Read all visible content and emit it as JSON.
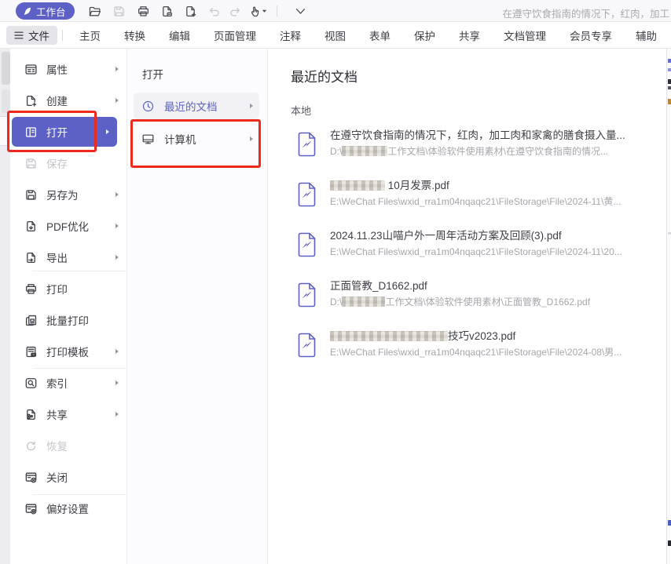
{
  "colors": {
    "accent": "#5d61c5",
    "annotation_red": "#ec2a1d",
    "disabled_gray": "#c6c6cc"
  },
  "titlebar": {
    "workbench_label": "工作台",
    "document_title": "在遵守饮食指南的情况下，红肉，加工"
  },
  "menubar": {
    "items": [
      "文件",
      "主页",
      "转换",
      "编辑",
      "页面管理",
      "注释",
      "视图",
      "表单",
      "保护",
      "共享",
      "文档管理",
      "会员专享",
      "辅助"
    ],
    "active_item": "文件"
  },
  "file_menu": {
    "items": [
      {
        "label": "属性",
        "icon": "properties-icon",
        "has_submenu": true
      },
      {
        "label": "创建",
        "icon": "create-icon",
        "has_submenu": true
      },
      {
        "label": "打开",
        "icon": "open-icon",
        "has_submenu": true,
        "selected": true
      },
      {
        "label": "保存",
        "icon": "save-icon",
        "disabled": true
      },
      {
        "label": "另存为",
        "icon": "save-as-icon",
        "has_submenu": true
      },
      {
        "label": "PDF优化",
        "icon": "pdf-optimize-icon",
        "has_submenu": true
      },
      {
        "label": "导出",
        "icon": "export-icon",
        "has_submenu": true
      },
      {
        "label": "打印",
        "icon": "print-icon"
      },
      {
        "label": "批量打印",
        "icon": "batch-print-icon"
      },
      {
        "label": "打印模板",
        "icon": "print-template-icon",
        "has_submenu": true
      },
      {
        "label": "索引",
        "icon": "index-icon",
        "has_submenu": true
      },
      {
        "label": "共享",
        "icon": "share-icon",
        "has_submenu": true
      },
      {
        "label": "恢复",
        "icon": "restore-icon",
        "disabled": true
      },
      {
        "label": "关闭",
        "icon": "close-doc-icon"
      },
      {
        "label": "偏好设置",
        "icon": "preferences-icon"
      }
    ]
  },
  "open_panel": {
    "title": "打开",
    "items": [
      {
        "label": "最近的文档",
        "icon": "clock-icon",
        "selected": true,
        "has_submenu": true
      },
      {
        "label": "计算机",
        "icon": "computer-icon",
        "has_submenu": true
      }
    ]
  },
  "main": {
    "heading": "最近的文档",
    "section_label": "本地",
    "documents": [
      {
        "title": "在遵守饮食指南的情况下，红肉，加工肉和家禽的膳食摄入量...",
        "path_start": "D:\\",
        "path_redacted": true,
        "path_end": "工作文档\\体验软件使用素材\\在遵守饮食指南的情况..."
      },
      {
        "title_redacted": true,
        "title": "10月发票.pdf",
        "path_start": "E:\\WeChat Files\\wxid_rra1m04nqaqc21\\FileStorage\\File\\2024-11\\黄..."
      },
      {
        "title": "2024.11.23山喵户外一周年活动方案及回顾(3).pdf",
        "path_start": "E:\\WeChat Files\\wxid_rra1m04nqaqc21\\FileStorage\\File\\2024-11\\20..."
      },
      {
        "title": "正面管教_D1662.pdf",
        "path_start": "D:\\",
        "path_redacted": true,
        "path_end": "工作文档\\体验软件使用素材\\正面管教_D1662.pdf"
      },
      {
        "title_redacted": true,
        "title": "技巧v2023.pdf",
        "path_start": "E:\\WeChat Files\\wxid_rra1m04nqaqc21\\FileStorage\\File\\2024-08\\男..."
      }
    ]
  }
}
